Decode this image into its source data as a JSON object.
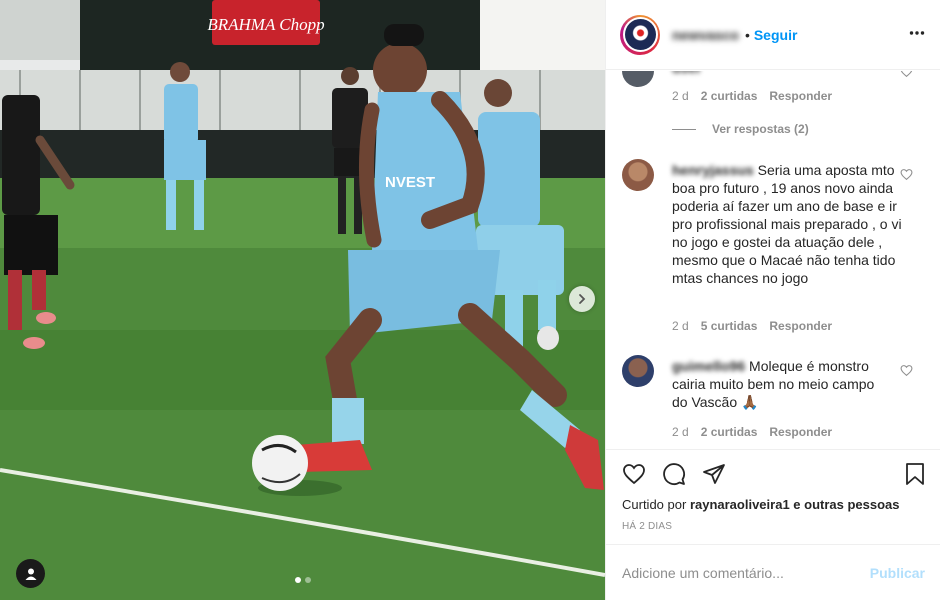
{
  "header": {
    "username": "newvasco",
    "separator": "•",
    "follow_label": "Seguir",
    "more_icon": "more-horizontal-icon"
  },
  "comments": [
    {
      "username": "user",
      "text": "",
      "time": "2 d",
      "likes": "2 curtidas",
      "reply": "Responder",
      "view_replies": "Ver respostas (2)"
    },
    {
      "username": "henryjassus",
      "text": "Seria uma aposta mto boa pro futuro , 19 anos novo ainda poderia aí fazer um ano de base e ir pro profissional mais preparado , o vi no jogo e gostei da atuação dele , mesmo que o Macaé não tenha tido mtas chances no jogo",
      "time": "2 d",
      "likes": "5 curtidas",
      "reply": "Responder"
    },
    {
      "username": "guimello96",
      "text": "Moleque é monstro cairia muito bem no meio campo do Vascão 🙏🏾",
      "time": "2 d",
      "likes": "2 curtidas",
      "reply": "Responder"
    }
  ],
  "actions": {
    "liked_prefix": "Curtido por",
    "liked_user": "raynaraoliveira1",
    "liked_suffix": "e outras pessoas",
    "posted_ago": "HÁ 2 DIAS"
  },
  "add_comment": {
    "placeholder": "Adicione um comentário...",
    "post_label": "Publicar"
  },
  "photo": {
    "sponsor_text": "NVEST",
    "banner_text": "BRAHMA Chopp",
    "slide_count": 2,
    "active_slide": 1
  },
  "colors": {
    "accent": "#0095f6",
    "post_disabled": "#b2dffc",
    "meta_gray": "#8e8e8e",
    "kit_blue": "#7fc3e6"
  }
}
